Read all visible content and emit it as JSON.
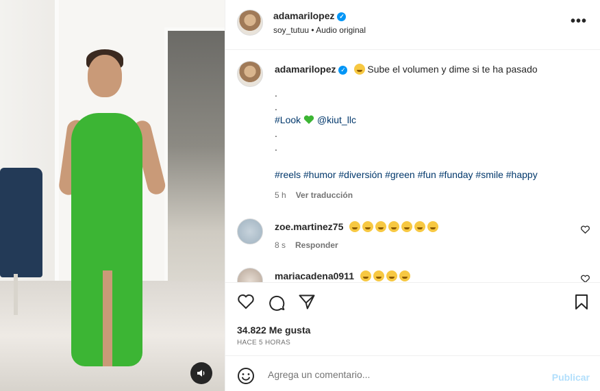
{
  "header": {
    "username": "adamarilopez",
    "audio_owner": "soy_tutuu",
    "audio_sep": " • ",
    "audio_label": "Audio original",
    "more": "•••"
  },
  "caption": {
    "username": "adamarilopez",
    "text": "Sube el volumen y dime si te ha pasado",
    "lines": [
      ".",
      ".",
      "#Look",
      "@kiut_llc",
      ".",
      ".",
      "#reels #humor #diversión #green #fun #funday #smile #happy"
    ],
    "time": "5 h",
    "translate": "Ver traducción"
  },
  "comments": [
    {
      "username": "zoe.martinez75",
      "emoji_count": 7,
      "time": "8 s",
      "reply": "Responder"
    },
    {
      "username": "mariacadena0911",
      "emoji_count": 4
    }
  ],
  "stats": {
    "likes": "34.822 Me gusta",
    "ago": "HACE 5 HORAS"
  },
  "composer": {
    "placeholder": "Agrega un comentario...",
    "publish": "Publicar"
  },
  "colors": {
    "accent": "#0095f6",
    "publish_disabled": "#b2dffc",
    "dress_green": "#3cb534",
    "link": "#00376b"
  }
}
